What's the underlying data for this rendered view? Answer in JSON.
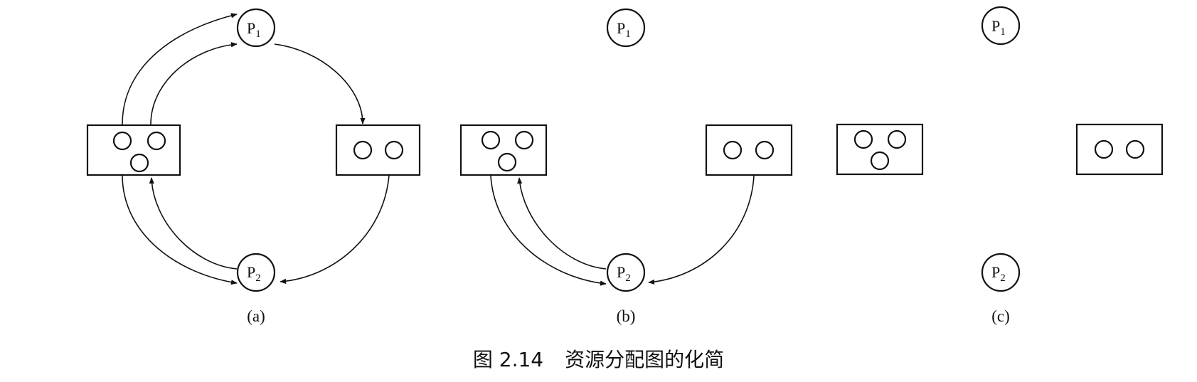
{
  "figure": {
    "caption_number": "图 2.14",
    "caption_text": "资源分配图的化简",
    "process_prefix": "P",
    "panels": [
      {
        "label": "(a)",
        "processes": [
          "1",
          "2"
        ],
        "resources": [
          {
            "units": 3
          },
          {
            "units": 2
          }
        ],
        "edges": [
          {
            "from": "R1",
            "to": "P1"
          },
          {
            "from": "R1",
            "to": "P1"
          },
          {
            "from": "P1",
            "to": "R2"
          },
          {
            "from": "R1",
            "to": "P2"
          },
          {
            "from": "P2",
            "to": "R1"
          },
          {
            "from": "R2",
            "to": "P2"
          }
        ]
      },
      {
        "label": "(b)",
        "processes": [
          "1",
          "2"
        ],
        "resources": [
          {
            "units": 3
          },
          {
            "units": 2
          }
        ],
        "edges": [
          {
            "from": "R1",
            "to": "P2"
          },
          {
            "from": "P2",
            "to": "R1"
          },
          {
            "from": "R2",
            "to": "P2"
          }
        ]
      },
      {
        "label": "(c)",
        "processes": [
          "1",
          "2"
        ],
        "resources": [
          {
            "units": 3
          },
          {
            "units": 2
          }
        ],
        "edges": []
      }
    ]
  }
}
